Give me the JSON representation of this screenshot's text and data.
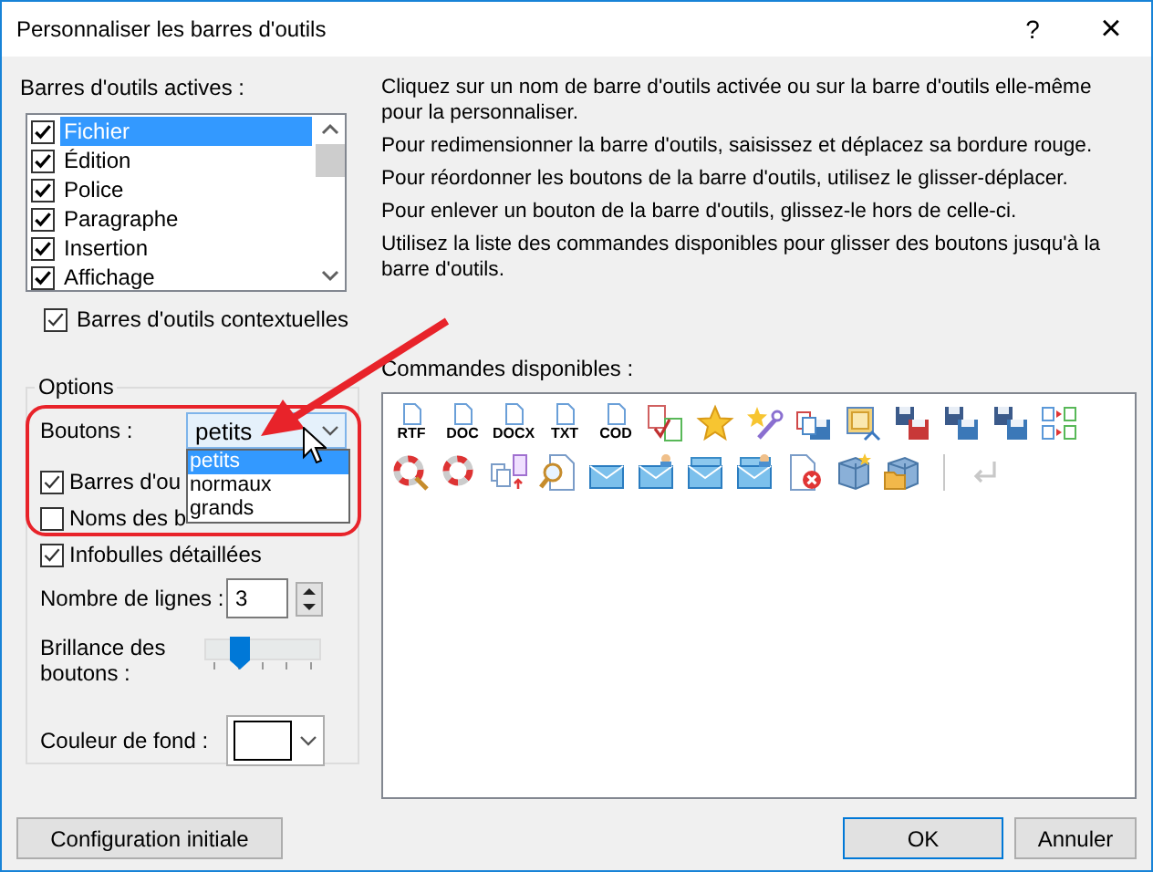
{
  "window": {
    "title": "Personnaliser les barres d'outils",
    "help": "?",
    "close": "×"
  },
  "active_toolbars": {
    "label": "Barres d'outils actives :",
    "items": [
      {
        "label": "Fichier",
        "checked": true,
        "selected": true
      },
      {
        "label": "Édition",
        "checked": true,
        "selected": false
      },
      {
        "label": "Police",
        "checked": true,
        "selected": false
      },
      {
        "label": "Paragraphe",
        "checked": true,
        "selected": false
      },
      {
        "label": "Insertion",
        "checked": true,
        "selected": false
      },
      {
        "label": "Affichage",
        "checked": true,
        "selected": false
      }
    ]
  },
  "contextual": {
    "label": "Barres d'outils contextuelles",
    "checked": true
  },
  "options": {
    "title": "Options",
    "buttons_label": "Boutons :",
    "buttons_value": "petits",
    "dropdown": {
      "open": true,
      "options": [
        {
          "label": "petits",
          "selected": true
        },
        {
          "label": "normaux",
          "selected": false
        },
        {
          "label": "grands",
          "selected": false
        }
      ]
    },
    "checks": [
      {
        "label": "Barres d'ou",
        "checked": true
      },
      {
        "label": "Noms des b",
        "checked": false
      },
      {
        "label": "Infobulles détaillées",
        "checked": true
      }
    ],
    "lines_label": "Nombre de lignes :",
    "lines_value": "3",
    "brightness_label": "Brillance des boutons :",
    "brightness": {
      "level": 0.25
    },
    "color_label": "Couleur de fond :"
  },
  "instructions": [
    "Cliquez sur un nom de barre d'outils activée ou sur la barre d'outils elle-même pour la personnaliser.",
    "Pour redimensionner la barre d'outils, saisissez et déplacez sa bordure rouge.",
    "Pour réordonner les boutons de la barre d'outils, utilisez le glisser-déplacer.",
    "Pour enlever un bouton de la barre d'outils, glissez-le hors de celle-ci.",
    "Utilisez la liste des commandes disponibles pour glisser des boutons jusqu'à la barre d'outils."
  ],
  "commands": {
    "label": "Commandes disponibles :",
    "items": [
      {
        "kind": "file",
        "label": "RTF"
      },
      {
        "kind": "file",
        "label": "DOC"
      },
      {
        "kind": "file",
        "label": "DOCX"
      },
      {
        "kind": "file",
        "label": "TXT"
      },
      {
        "kind": "file",
        "label": "COD"
      },
      {
        "kind": "copy-check"
      },
      {
        "kind": "star"
      },
      {
        "kind": "star-wrench"
      },
      {
        "kind": "save-copy"
      },
      {
        "kind": "window"
      },
      {
        "kind": "save-red"
      },
      {
        "kind": "save-multi"
      },
      {
        "kind": "save-stack"
      },
      {
        "kind": "arrows-docs"
      },
      {
        "kind": "lifebuoy-search"
      },
      {
        "kind": "lifebuoy"
      },
      {
        "kind": "pages-up"
      },
      {
        "kind": "page-search"
      },
      {
        "kind": "envelope"
      },
      {
        "kind": "envelope-person"
      },
      {
        "kind": "envelopes"
      },
      {
        "kind": "envelopes-person"
      },
      {
        "kind": "page-delete"
      },
      {
        "kind": "server-star"
      },
      {
        "kind": "server-folder"
      },
      {
        "kind": "separator"
      },
      {
        "kind": "return",
        "disabled": true
      }
    ]
  },
  "buttons": {
    "reset": "Configuration initiale",
    "ok": "OK",
    "cancel": "Annuler"
  }
}
